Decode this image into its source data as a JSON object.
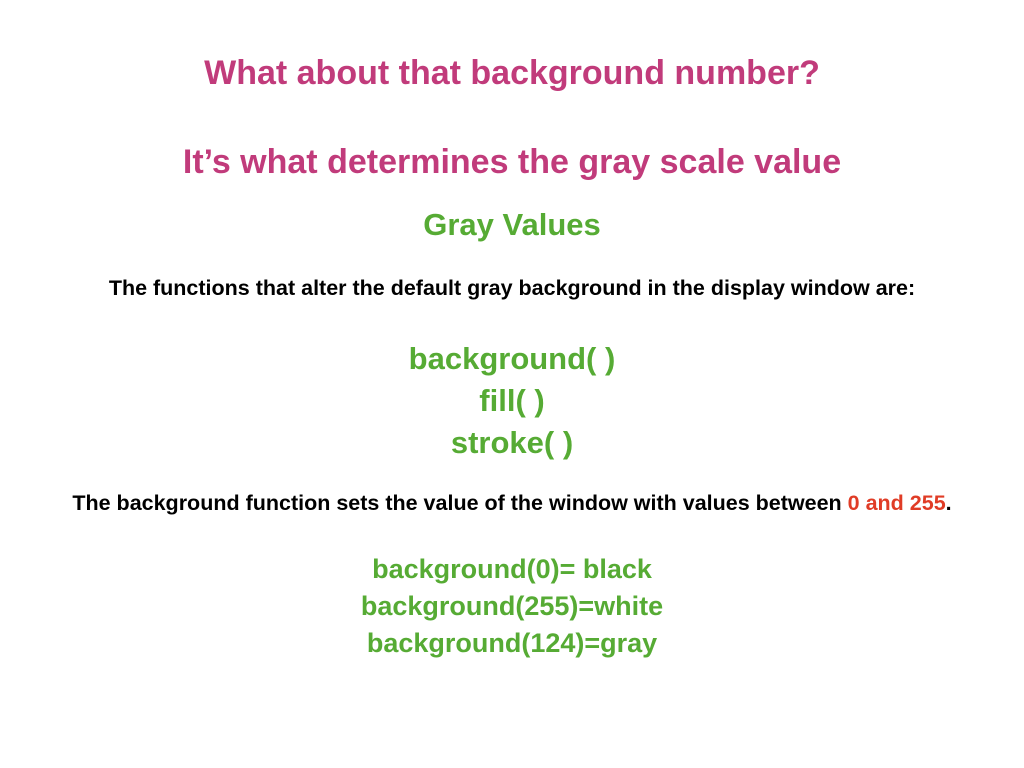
{
  "colors": {
    "heading": "#c13b7b",
    "accent_green": "#56ab34",
    "body_text": "#000000",
    "highlight_red": "#e03c26"
  },
  "slide": {
    "title_line1": "What about that background number?",
    "title_line2": "It’s what determines the gray scale value",
    "section_heading": "Gray Values",
    "intro": "The functions that alter the default gray background in the display window are:",
    "functions": [
      "background( )",
      "fill( )",
      "stroke( )"
    ],
    "description": {
      "before": "The background function sets the value of the window with values between ",
      "highlight": "0 and 255",
      "after": "."
    },
    "examples": [
      "background(0)= black",
      "background(255)=white",
      "background(124)=gray"
    ]
  }
}
